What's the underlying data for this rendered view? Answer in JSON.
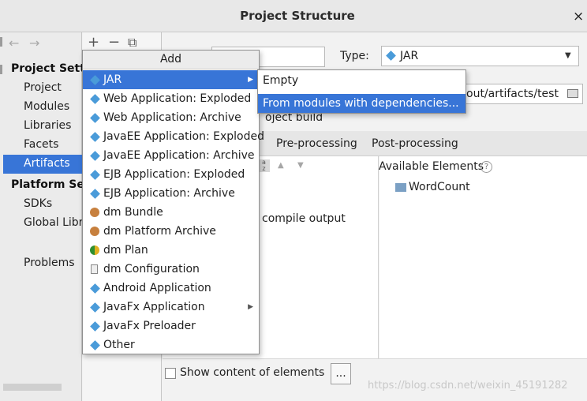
{
  "window": {
    "title": "Project Structure",
    "close": "×"
  },
  "sidebar": {
    "back": "←",
    "forward": "→",
    "project_settings_heading": "Project Settin",
    "project_items": [
      "Project",
      "Modules",
      "Libraries",
      "Facets",
      "Artifacts"
    ],
    "selected": "Artifacts",
    "platform_settings_heading": "Platform Setti",
    "platform_items": [
      "SDKs",
      "Global Libra"
    ],
    "problems": "Problems"
  },
  "list_toolbar": {
    "add": "+",
    "remove": "−",
    "copy": "⧉"
  },
  "form": {
    "type_label": "Type:",
    "type_value": "JAR",
    "output_dir_value": "out/artifacts/test",
    "build_text": "oject build"
  },
  "tabs": [
    "Pre-processing",
    "Post-processing"
  ],
  "available_elements": {
    "title": "Available Elements",
    "help": "?",
    "items": [
      "WordCount"
    ]
  },
  "left_panel": {
    "compile_output": "compile output"
  },
  "bottom": {
    "show_content_label": "Show content of elements",
    "more_button": "..."
  },
  "add_menu": {
    "title": "Add",
    "items": [
      {
        "label": "JAR",
        "icon": "diamond-icon",
        "submenu": true,
        "selected": true
      },
      {
        "label": "Web Application: Exploded",
        "icon": "web-diamond-icon"
      },
      {
        "label": "Web Application: Archive",
        "icon": "web-diamond-icon"
      },
      {
        "label": "JavaEE Application: Exploded",
        "icon": "javaee-icon"
      },
      {
        "label": "JavaEE Application: Archive",
        "icon": "javaee-icon"
      },
      {
        "label": "EJB Application: Exploded",
        "icon": "ejb-icon"
      },
      {
        "label": "EJB Application: Archive",
        "icon": "ejb-icon"
      },
      {
        "label": "dm Bundle",
        "icon": "dm-bundle-icon"
      },
      {
        "label": "dm Platform Archive",
        "icon": "dm-platform-icon"
      },
      {
        "label": "dm Plan",
        "icon": "dm-plan-icon"
      },
      {
        "label": "dm Configuration",
        "icon": "document-icon"
      },
      {
        "label": "Android Application",
        "icon": "diamond-icon"
      },
      {
        "label": "JavaFx Application",
        "icon": "diamond-icon",
        "submenu": true
      },
      {
        "label": "JavaFx Preloader",
        "icon": "diamond-icon"
      },
      {
        "label": "Other",
        "icon": "diamond-icon"
      }
    ]
  },
  "jar_submenu": {
    "items": [
      {
        "label": "Empty",
        "selected": false
      },
      {
        "label": "From modules with dependencies...",
        "selected": true
      }
    ]
  },
  "watermark": "https://blog.csdn.net/weixin_45191282",
  "colors": {
    "selection": "#3875d7",
    "diamond": "#4a9bd9"
  }
}
